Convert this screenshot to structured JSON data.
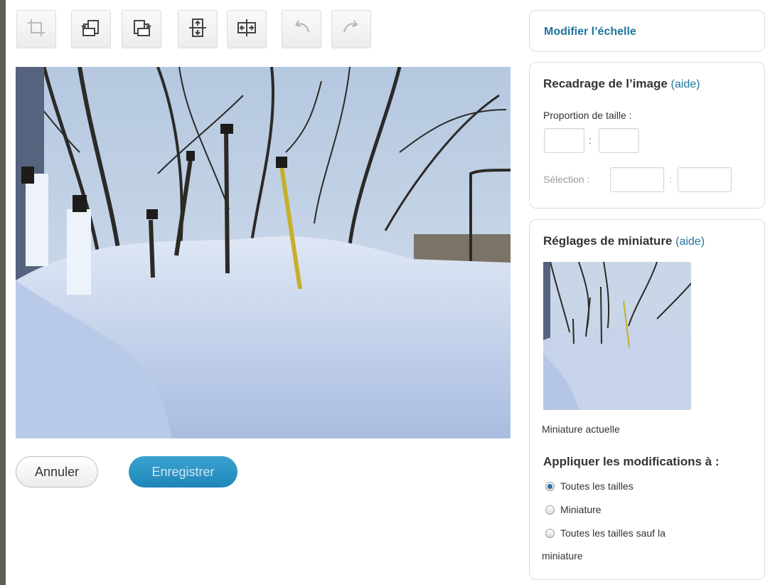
{
  "toolbar": {
    "items": [
      {
        "name": "crop-icon",
        "enabled": false
      },
      {
        "name": "rotate-left-icon",
        "enabled": true
      },
      {
        "name": "rotate-right-icon",
        "enabled": true
      },
      {
        "name": "flip-vertical-icon",
        "enabled": true
      },
      {
        "name": "flip-horizontal-icon",
        "enabled": true
      },
      {
        "name": "undo-icon",
        "enabled": false
      },
      {
        "name": "redo-icon",
        "enabled": false
      }
    ]
  },
  "actions": {
    "cancel_label": "Annuler",
    "save_label": "Enregistrer"
  },
  "scale_panel": {
    "title": "Modifier l’échelle"
  },
  "crop_panel": {
    "title": "Recadrage de l’image",
    "help": "(aide)",
    "ratio_label": "Proportion de taille :",
    "ratio_separator": ":",
    "selection_label": "Sélection :",
    "selection_separator": ":"
  },
  "thumbnail_panel": {
    "title": "Réglages de miniature",
    "help": "(aide)",
    "current_label": "Miniature actuelle",
    "apply_title": "Appliquer les modifications à :",
    "options": [
      {
        "label": "Toutes les tailles",
        "selected": true
      },
      {
        "label": "Miniature",
        "selected": false
      },
      {
        "label": "Toutes les tailles sauf la",
        "label_cont": "miniature",
        "selected": false
      }
    ]
  },
  "colors": {
    "accent": "#21759b",
    "save_button": "#2a93c6",
    "sky": "#c6d6e9",
    "snow": "#c9d5ea"
  }
}
